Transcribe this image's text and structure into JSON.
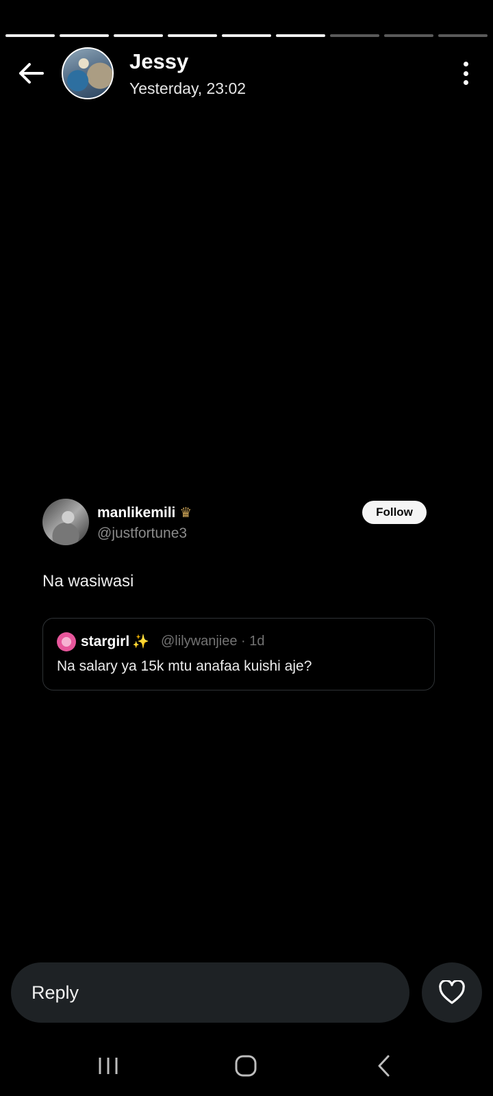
{
  "story": {
    "progress": {
      "total_segments": 9,
      "completed_segments": 6
    },
    "title": "Jessy",
    "timestamp": "Yesterday, 23:02",
    "icons": {
      "back": "arrow-left-icon",
      "more": "more-vertical-icon"
    }
  },
  "tweet": {
    "author_name": "manlikemili",
    "author_badge_icon": "crown-icon",
    "handle": "@justfortune3",
    "follow_label": "Follow",
    "text": "Na wasiwasi",
    "quote": {
      "author_name": "stargirl",
      "author_emoji": "✨",
      "handle_meta": "@lilywanjiee · 1d",
      "text": "Na salary ya 15k mtu anafaa kuishi aje?"
    }
  },
  "reply_bar": {
    "placeholder": "Reply",
    "like_icon": "heart-icon"
  },
  "system_nav": {
    "icons": [
      "recents-icon",
      "home-icon",
      "back-icon"
    ]
  },
  "colors": {
    "background": "#000000",
    "progress_done": "#f2f2f2",
    "progress_pending": "#5a5a5a",
    "input_bg": "#1e2225",
    "follow_bg": "#f5f5f5"
  }
}
